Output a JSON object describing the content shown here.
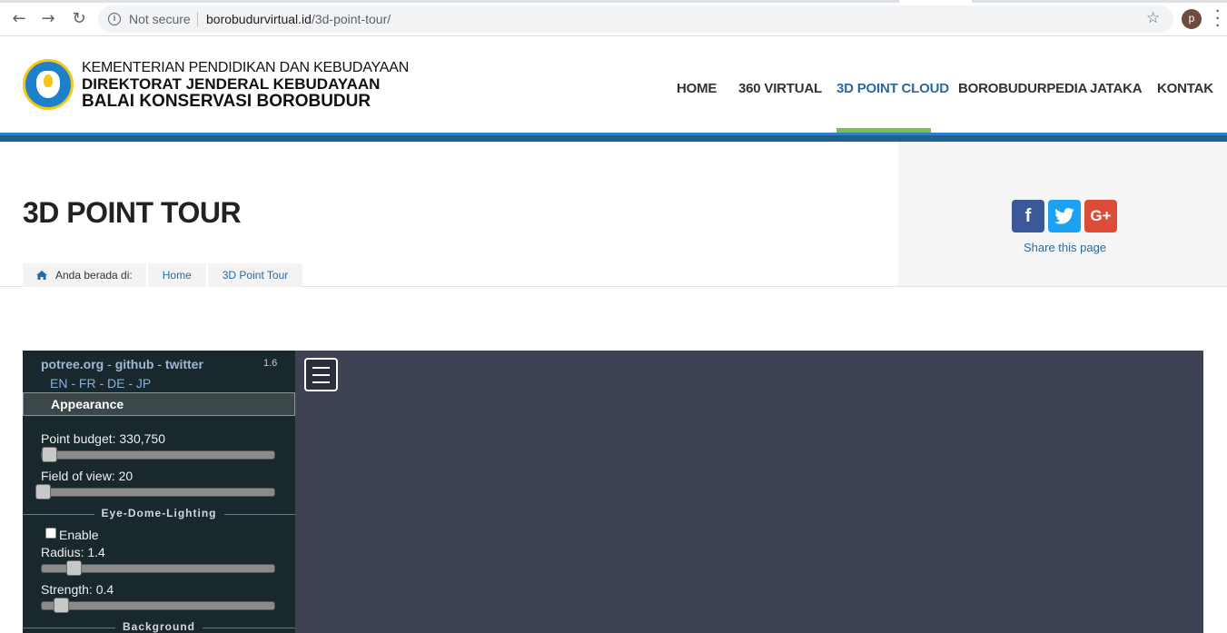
{
  "browser": {
    "not_secure": "Not secure",
    "url_domain": "borobudurvirtual.id",
    "url_path": "/3d-point-tour/",
    "profile_initial": "p"
  },
  "header": {
    "org_line1": "KEMENTERIAN PENDIDIKAN DAN KEBUDAYAAN",
    "org_line2": "DIREKTORAT JENDERAL KEBUDAYAAN",
    "org_line3": "BALAI KONSERVASI BOROBUDUR",
    "nav": [
      {
        "label": "HOME",
        "active": false
      },
      {
        "label": "360 VIRTUAL",
        "active": false
      },
      {
        "label": "3D POINT CLOUD",
        "active": true
      },
      {
        "label": "BOROBUDURPEDIA",
        "active": false
      },
      {
        "label": "JATAKA",
        "active": false
      },
      {
        "label": "KONTAK",
        "active": false
      }
    ]
  },
  "page": {
    "title": "3D POINT TOUR",
    "breadcrumb": {
      "label": "Anda berada di:",
      "items": [
        "Home",
        "3D Point Tour"
      ]
    },
    "share": {
      "text": "Share this page",
      "buttons": [
        "f",
        "t",
        "G+"
      ]
    }
  },
  "viewer": {
    "links": [
      "potree.org",
      "github",
      "twitter"
    ],
    "version": "1.6",
    "languages": "EN - FR - DE - JP",
    "section": "Appearance",
    "point_budget_label": "Point budget: 330,750",
    "fov_label": "Field of view: 20",
    "edl_title": "Eye-Dome-Lighting",
    "enable_label": "Enable",
    "radius_label": "Radius: 1.4",
    "strength_label": "Strength: 0.4",
    "background_title": "Background",
    "colors": {
      "sidebar_bg": "#19282c",
      "canvas_bg": "#3e4354",
      "link": "#a0b8d8"
    }
  }
}
